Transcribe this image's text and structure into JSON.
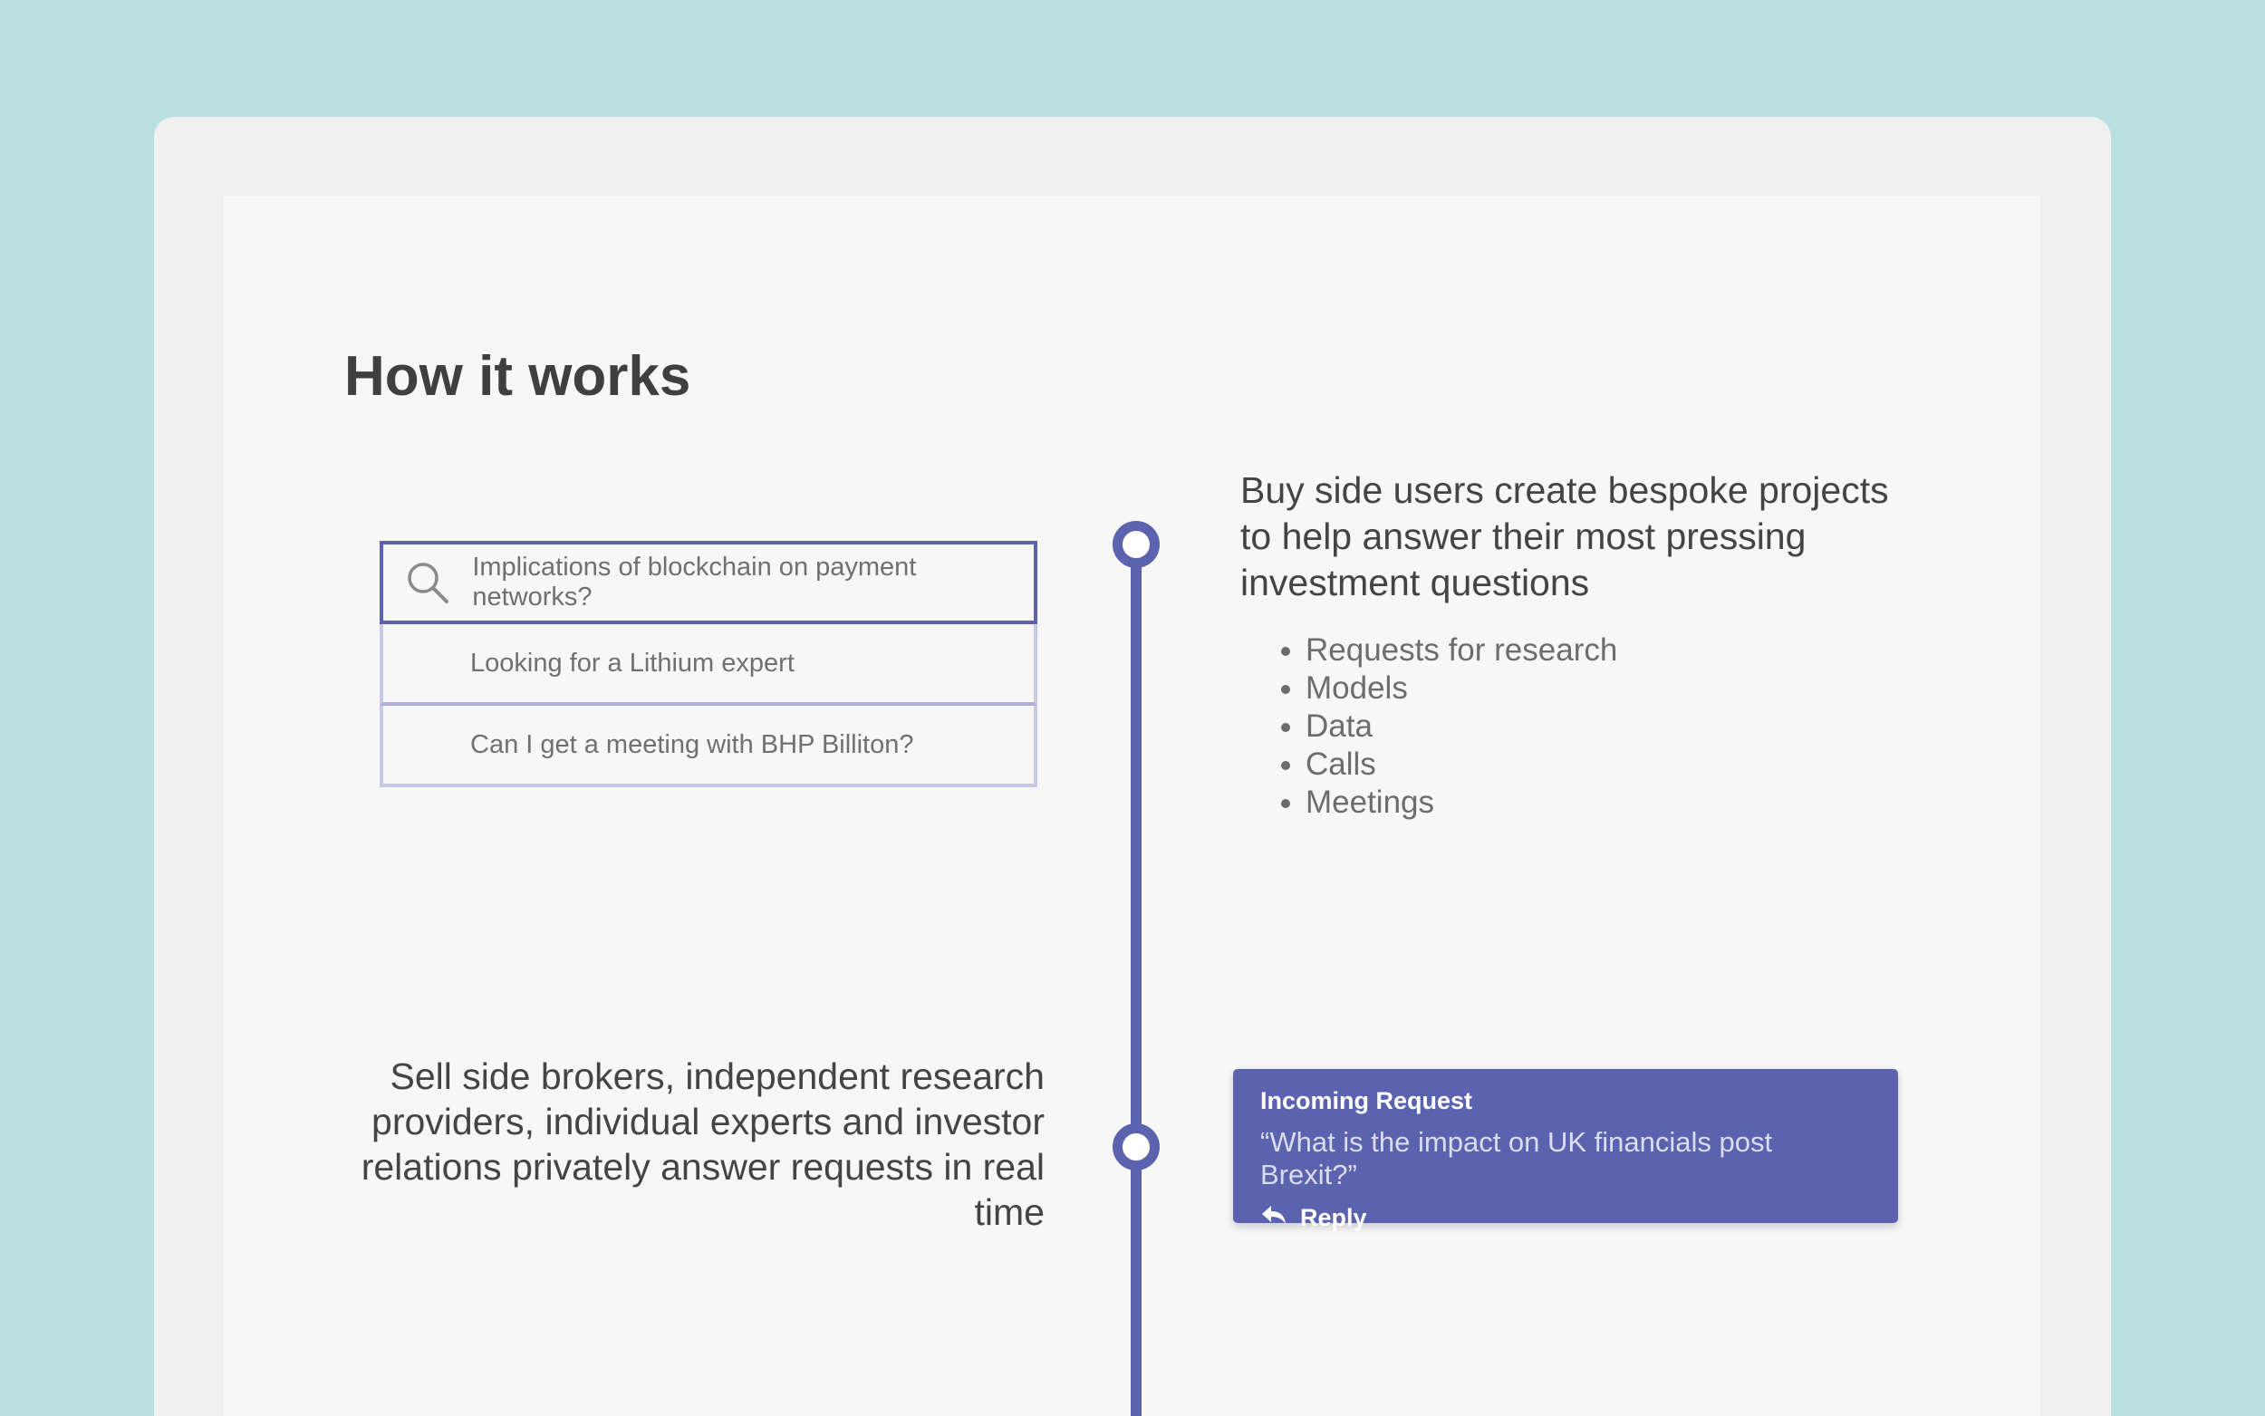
{
  "page": {
    "title": "How it works"
  },
  "search": {
    "query": "Implications of blockchain on payment networks?",
    "suggestions": [
      "Looking for a Lithium expert",
      "Can I get a meeting with BHP Billiton?"
    ]
  },
  "step_one": {
    "heading": "Buy side users create bespoke projects to help answer their most pressing investment questions",
    "items": [
      "Requests for research",
      "Models",
      "Data",
      "Calls",
      "Meetings"
    ]
  },
  "step_two": {
    "heading": "Sell side brokers, independent research providers, individual experts and investor relations privately answer requests in real time"
  },
  "incoming_card": {
    "label": "Incoming Request",
    "quote": "“What is the impact on UK financials post Brexit?”",
    "reply_label": "Reply"
  },
  "colors": {
    "background": "#b9e0e0",
    "accent": "#5c63ae",
    "suggestion_border": "#c6c8e6"
  },
  "icons": [
    "search-icon",
    "reply-arrow-icon"
  ]
}
